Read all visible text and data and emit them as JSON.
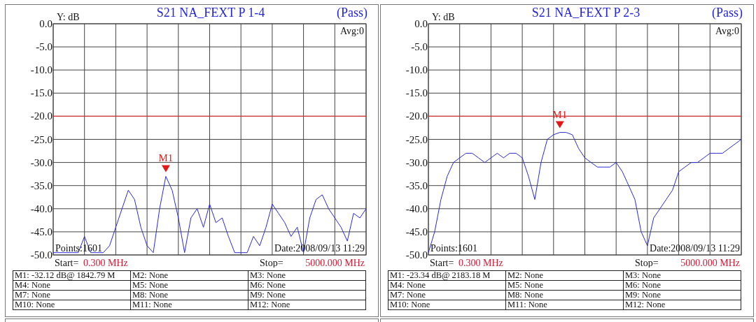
{
  "panels": [
    {
      "title": "S21  NA_FEXT P 1-4",
      "verdict": "(Pass)",
      "avg": "Avg:0",
      "points": "Points:1601",
      "date": "Date:2008/09/13 11:29",
      "start_label": "Start=",
      "start_value": "0.300 MHz",
      "stop_label": "Stop=",
      "stop_value": "5000.000 MHz",
      "marker_label": "M1",
      "chart_data": {
        "type": "line",
        "ylabel": "Y: dB",
        "ylim": [
          -50,
          0
        ],
        "yticks": [
          {
            "value": 0,
            "label": "0.0"
          },
          {
            "value": -5,
            "label": "-5.0"
          },
          {
            "value": -10,
            "label": "-10.0"
          },
          {
            "value": -15,
            "label": "-15.0"
          },
          {
            "value": -20,
            "label": "-20.0"
          },
          {
            "value": -25,
            "label": "-25.0"
          },
          {
            "value": -30,
            "label": "-30.0"
          },
          {
            "value": -35,
            "label": "-35.0"
          },
          {
            "value": -40,
            "label": "-40.0"
          },
          {
            "value": -45,
            "label": "-45.0"
          },
          {
            "value": -50,
            "label": "-50.0"
          }
        ],
        "categories": [
          null,
          null,
          null,
          null,
          null,
          null,
          null,
          null,
          null,
          null,
          null,
          null,
          null,
          null,
          null,
          null,
          null,
          null,
          null,
          null,
          null,
          null,
          null,
          null,
          null,
          null,
          null,
          null,
          null,
          null,
          null,
          null,
          null,
          null,
          null,
          null,
          null,
          null,
          null,
          null,
          null,
          null,
          null,
          null,
          null,
          null,
          null,
          null,
          null,
          null,
          null
        ],
        "series": [
          {
            "color": "#2b2bd6",
            "values": [
              -49.5,
              -49.5,
              -49.5,
              -49.5,
              -49.5,
              -46,
              -49.5,
              -49.5,
              -49.5,
              -48,
              -44,
              -40,
              -36,
              -38,
              -44,
              -48,
              -49.5,
              -40,
              -33,
              -36,
              -42,
              -49.5,
              -42,
              -40,
              -44,
              -39,
              -43,
              -42,
              -46,
              -49.5,
              -49.5,
              -49.5,
              -46,
              -48,
              -44,
              -39,
              -41,
              -43,
              -46,
              -44,
              -49.5,
              -42,
              -38,
              -37,
              -40,
              -42,
              -44,
              -47,
              -41,
              -42,
              -40
            ]
          }
        ],
        "grid": true,
        "ref_lines": [
          {
            "axis": "y",
            "value": -20
          }
        ]
      },
      "markers": [
        [
          "M1: -32.12 dB@ 1842.79 M",
          "M2: None",
          "M3: None"
        ],
        [
          "M4: None",
          "M5: None",
          "M6: None"
        ],
        [
          "M7: None",
          "M8: None",
          "M9: None"
        ],
        [
          "M10: None",
          "M11: None",
          "M12: None"
        ]
      ]
    },
    {
      "title": "S21  NA_FEXT P 2-3",
      "verdict": "(Pass)",
      "avg": "Avg:0",
      "points": "Points:1601",
      "date": "Date:2008/09/13 11:29",
      "start_label": "Start=",
      "start_value": "0.300 MHz",
      "stop_label": "Stop=",
      "stop_value": "5000.000 MHz",
      "marker_label": "M1",
      "chart_data": {
        "type": "line",
        "ylabel": "Y: dB",
        "ylim": [
          -50,
          0
        ],
        "yticks": [
          {
            "value": 0,
            "label": "0.0"
          },
          {
            "value": -5,
            "label": "-5.0"
          },
          {
            "value": -10,
            "label": "-10.0"
          },
          {
            "value": -15,
            "label": "-15.0"
          },
          {
            "value": -20,
            "label": "-20.0"
          },
          {
            "value": -25,
            "label": "-25.0"
          },
          {
            "value": -30,
            "label": "-30.0"
          },
          {
            "value": -35,
            "label": "-35.0"
          },
          {
            "value": -40,
            "label": "-40.0"
          },
          {
            "value": -45,
            "label": "-45.0"
          },
          {
            "value": -50,
            "label": "-50.0"
          }
        ],
        "categories": [
          null,
          null,
          null,
          null,
          null,
          null,
          null,
          null,
          null,
          null,
          null,
          null,
          null,
          null,
          null,
          null,
          null,
          null,
          null,
          null,
          null,
          null,
          null,
          null,
          null,
          null,
          null,
          null,
          null,
          null,
          null,
          null,
          null,
          null,
          null,
          null,
          null,
          null,
          null,
          null,
          null,
          null,
          null,
          null,
          null,
          null,
          null,
          null,
          null,
          null,
          null
        ],
        "series": [
          {
            "color": "#2b2bd6",
            "values": [
              -49.5,
              -45,
              -38,
              -33,
              -30,
              -29,
              -28,
              -28,
              -29,
              -30,
              -29,
              -28,
              -29,
              -28,
              -28,
              -29,
              -33,
              -38,
              -30,
              -25,
              -24,
              -23.5,
              -23.5,
              -24,
              -27,
              -29,
              -30,
              -31,
              -31,
              -31,
              -30,
              -32,
              -35,
              -38,
              -45,
              -48,
              -42,
              -40,
              -38,
              -36,
              -32,
              -31,
              -30,
              -30,
              -29,
              -28,
              -28,
              -28,
              -27,
              -26,
              -25
            ]
          }
        ],
        "grid": true,
        "ref_lines": [
          {
            "axis": "y",
            "value": -20
          }
        ]
      },
      "markers": [
        [
          "M1: -23.34 dB@ 2183.18 M",
          "M2: None",
          "M3: None"
        ],
        [
          "M4: None",
          "M5: None",
          "M6: None"
        ],
        [
          "M7: None",
          "M8: None",
          "M9: None"
        ],
        [
          "M10: None",
          "M11: None",
          "M12: None"
        ]
      ]
    }
  ]
}
